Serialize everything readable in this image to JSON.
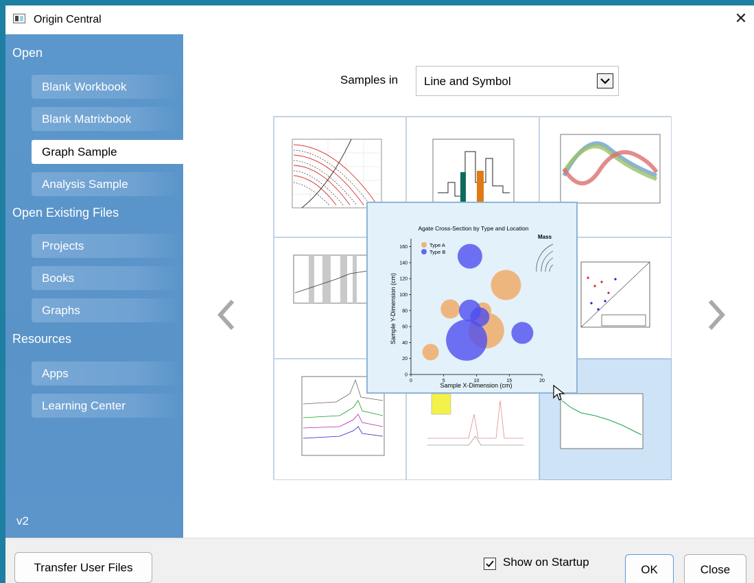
{
  "window": {
    "title": "Origin Central"
  },
  "sidebar": {
    "sections": [
      {
        "header": "Open",
        "items": [
          "Blank Workbook",
          "Blank Matrixbook",
          "Graph Sample",
          "Analysis Sample"
        ]
      },
      {
        "header": "Open Existing Files",
        "items": [
          "Projects",
          "Books",
          "Graphs"
        ]
      },
      {
        "header": "Resources",
        "items": [
          "Apps",
          "Learning Center"
        ]
      }
    ],
    "active_item": "Graph Sample",
    "version": "v2"
  },
  "main": {
    "samples_label": "Samples in",
    "samples_select": {
      "value": "Line and Symbol"
    },
    "preview": {
      "title": "Agate Cross-Section by Type and Location",
      "xlabel": "Sample X-Dimension (cm)",
      "ylabel": "Sample Y-Dimension (cm)",
      "legend": [
        "Type A",
        "Type B"
      ],
      "mass_label": "Mass",
      "colors": {
        "type_a": "#f0a860",
        "type_b": "#4f4ff0"
      }
    }
  },
  "footer": {
    "transfer_button": "Transfer User Files",
    "show_on_startup": {
      "label": "Show on Startup",
      "checked": true
    },
    "ok_button": "OK",
    "close_button": "Close"
  },
  "chart_data": {
    "type": "scatter",
    "title": "Agate Cross-Section by Type and Location",
    "xlabel": "Sample X-Dimension (cm)",
    "ylabel": "Sample Y-Dimension (cm)",
    "xlim": [
      0,
      20
    ],
    "ylim": [
      0,
      170
    ],
    "x_ticks": [
      0,
      5,
      10,
      15,
      20
    ],
    "y_ticks": [
      0,
      20,
      40,
      60,
      80,
      100,
      120,
      140,
      160
    ],
    "series": [
      {
        "name": "Type A",
        "points": [
          {
            "x": 3,
            "y": 28,
            "size": 12
          },
          {
            "x": 6,
            "y": 82,
            "size": 14
          },
          {
            "x": 11.5,
            "y": 55,
            "size": 26
          },
          {
            "x": 14.5,
            "y": 112,
            "size": 22
          },
          {
            "x": 11,
            "y": 80,
            "size": 12
          }
        ]
      },
      {
        "name": "Type B",
        "points": [
          {
            "x": 9,
            "y": 148,
            "size": 18
          },
          {
            "x": 9,
            "y": 80,
            "size": 16
          },
          {
            "x": 8.5,
            "y": 43,
            "size": 30
          },
          {
            "x": 17,
            "y": 52,
            "size": 16
          },
          {
            "x": 10.5,
            "y": 72,
            "size": 14
          }
        ]
      }
    ]
  }
}
